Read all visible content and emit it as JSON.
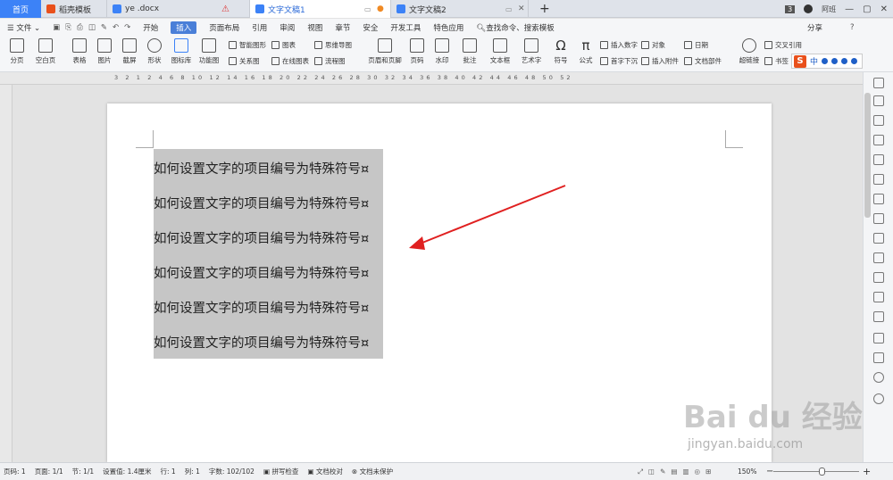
{
  "tabs": [
    {
      "label": "首页"
    },
    {
      "label": "稻壳模板"
    },
    {
      "label": "ye .docx"
    },
    {
      "label": "文字文稿1"
    },
    {
      "label": "文字文稿2"
    }
  ],
  "window": {
    "badge": "3",
    "user": "阿班"
  },
  "menu": {
    "file": "文件",
    "items": [
      "开始",
      "插入",
      "页面布局",
      "引用",
      "审阅",
      "视图",
      "章节",
      "安全",
      "开发工具",
      "特色应用"
    ],
    "active": "插入",
    "search": "查找命令、搜索模板",
    "share": "分享"
  },
  "ribbon": {
    "page_break": "分页",
    "blank_page": "空白页",
    "table": "表格",
    "picture": "图片",
    "screenshot": "截屏",
    "shape": "形状",
    "gallery": "图标库",
    "function_chart": "功能图",
    "smart_art": "智能图形",
    "chart": "图表",
    "mind_map": "思维导图",
    "relation_chart": "关系图",
    "online_chart": "在线图表",
    "flow_chart": "流程图",
    "header_footer": "页眉和页脚",
    "page_number": "页码",
    "watermark": "水印",
    "comment": "批注",
    "textbox": "文本框",
    "art_text": "艺术字",
    "symbol": "符号",
    "formula": "公式",
    "insert_number": "插入数字",
    "drop_cap": "首字下沉",
    "object": "对象",
    "attachment": "插入附件",
    "date": "日期",
    "doc_parts": "文档部件",
    "hyperlink": "超链接",
    "bookmark": "书签",
    "cross_ref": "交叉引用"
  },
  "ruler": "3 2 1   2 4 6 8 10 12 14 16 18 20 22 24 26 28 30 32 34 36 38 40 42 44 46 48 50 52",
  "document": {
    "lines": [
      "如何设置文字的项目编号为特殊符号¤",
      "如何设置文字的项目编号为特殊符号¤",
      "如何设置文字的项目编号为特殊符号¤",
      "如何设置文字的项目编号为特殊符号¤",
      "如何设置文字的项目编号为特殊符号¤",
      "如何设置文字的项目编号为特殊符号¤"
    ]
  },
  "ime": {
    "logo": "S",
    "mode": "中"
  },
  "watermark": {
    "brand": "Bai du 经验",
    "url": "jingyan.baidu.com"
  },
  "status": {
    "page_no": "页码: 1",
    "pages": "页面: 1/1",
    "section": "节: 1/1",
    "setting": "设置值: 1.4厘米",
    "row": "行: 1",
    "col": "列: 1",
    "words": "字数: 102/102",
    "spell": "拼写检查",
    "proof": "文档校对",
    "protect": "文档未保护",
    "zoom": "150%"
  },
  "colors": {
    "accent": "#3c82f7",
    "arrow": "#e02020",
    "selection": "#c6c6c6"
  }
}
